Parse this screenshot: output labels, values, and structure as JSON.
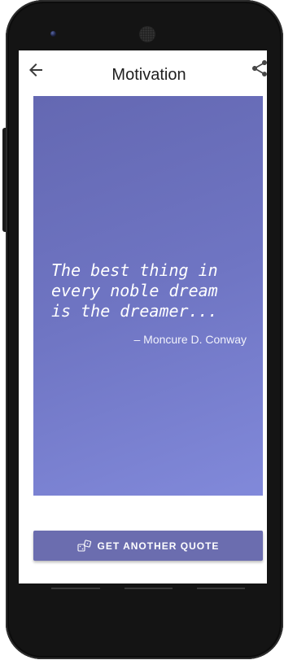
{
  "app": {
    "title": "Motivation"
  },
  "icons": {
    "back": "arrow-left-icon",
    "share": "share-icon",
    "dice": "dice-icon",
    "camera": "front-camera-icon",
    "speaker": "speaker-grille-icon"
  },
  "quote": {
    "text": "The best thing in every noble dream is the dreamer...",
    "author": "– Moncure D. Conway"
  },
  "actions": {
    "get_quote_label": "GET ANOTHER QUOTE"
  },
  "colors": {
    "card_gradient_start": "#6468b2",
    "card_gradient_end": "#8189da",
    "button": "#6b6daf",
    "text_on_accent": "#ffffff"
  }
}
